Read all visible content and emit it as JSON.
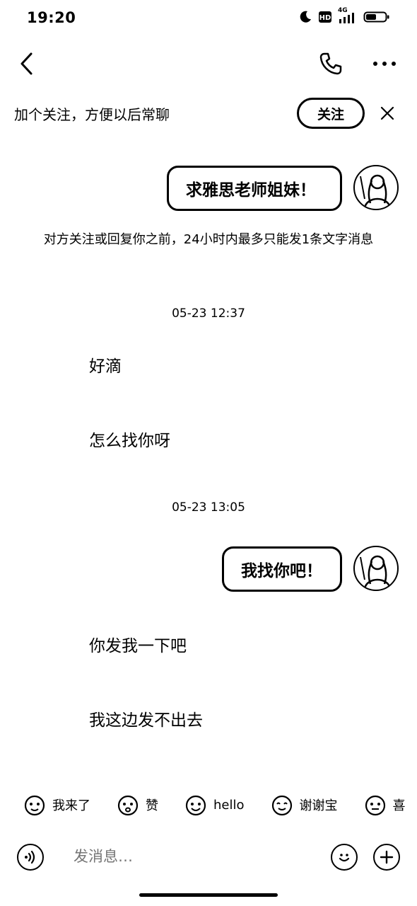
{
  "status_bar": {
    "time": "19:20",
    "icons": [
      "moon-icon",
      "hd-icon",
      "signal-icon",
      "battery-icon"
    ],
    "network": "4G"
  },
  "nav": {
    "icons": [
      "back-icon",
      "phone-icon",
      "more-icon"
    ]
  },
  "follow_banner": {
    "text": "加个关注，方便以后常聊",
    "button_label": "关注"
  },
  "messages": [
    {
      "type": "outgoing",
      "text": "求雅思老师姐妹！"
    },
    {
      "type": "system",
      "text": "对方关注或回复你之前，24小时内最多只能发1条文字消息"
    },
    {
      "type": "timestamp",
      "text": "05-23 12:37"
    },
    {
      "type": "incoming",
      "text": "好滴"
    },
    {
      "type": "incoming",
      "text": "怎么找你呀"
    },
    {
      "type": "timestamp",
      "text": "05-23 13:05"
    },
    {
      "type": "outgoing",
      "text": "我找你吧！"
    },
    {
      "type": "incoming",
      "text": "你发我一下吧"
    },
    {
      "type": "incoming",
      "text": "我这边发不出去"
    }
  ],
  "quick_replies": [
    {
      "label": "我来了",
      "icon": "sticker-icon"
    },
    {
      "label": "赞",
      "icon": "sticker-icon"
    },
    {
      "label": "hello",
      "icon": "sticker-icon"
    },
    {
      "label": "谢谢宝",
      "icon": "sticker-icon"
    },
    {
      "label": "喜",
      "icon": "sticker-icon"
    }
  ],
  "input": {
    "placeholder": "发消息…"
  },
  "colors": {
    "foreground": "#000000",
    "background": "#ffffff"
  }
}
